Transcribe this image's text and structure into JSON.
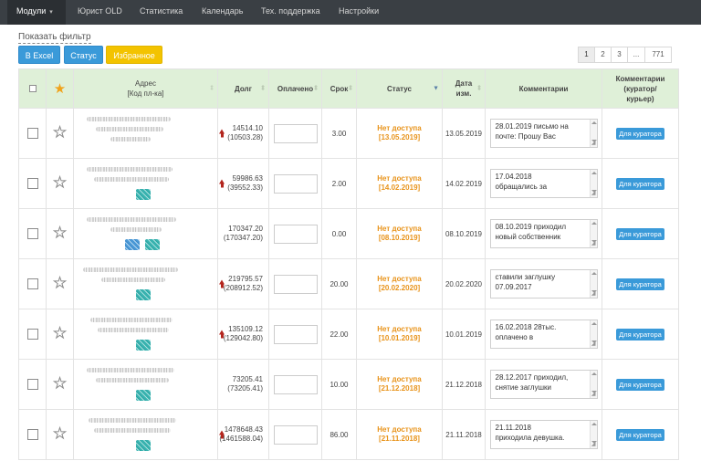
{
  "nav": {
    "items": [
      {
        "label": "Модули",
        "active": true,
        "has_caret": true
      },
      {
        "label": "Юрист OLD",
        "active": false
      },
      {
        "label": "Статистика",
        "active": false
      },
      {
        "label": "Календарь",
        "active": false
      },
      {
        "label": "Тех. поддержка",
        "active": false
      },
      {
        "label": "Настройки",
        "active": false
      }
    ]
  },
  "toolbar": {
    "show_filter": "Показать фильтр",
    "excel_label": "В Excel",
    "status_label": "Статус",
    "favorites_label": "Избранное"
  },
  "pagination": {
    "pages": [
      "1",
      "2",
      "3",
      "...",
      "771"
    ],
    "current": "1"
  },
  "table": {
    "headers": {
      "address": "Адрес",
      "address_sub": "[Код пл-ка]",
      "debt": "Долг",
      "paid": "Оплачено",
      "term": "Срок",
      "status": "Статус",
      "date": "Дата",
      "date_sub": "изм.",
      "comments": "Комментарии",
      "curator_comments_1": "Комментарии",
      "curator_comments_2": "(куратор/",
      "curator_comments_3": "курьер)"
    },
    "rows": [
      {
        "debt": "14514.10",
        "debt_sub": "(10503.28)",
        "debt_up": true,
        "term": "3.00",
        "status": "Нет доступа",
        "status_date": "[13.05.2019]",
        "date": "13.05.2019",
        "comment_1": "28.01.2019 письмо на",
        "comment_2": "почте: Прошу Вас",
        "curator_btn": "Для куратора"
      },
      {
        "debt": "59986.63",
        "debt_sub": "(39552.33)",
        "debt_up": true,
        "term": "2.00",
        "status": "Нет доступа",
        "status_date": "[14.02.2019]",
        "date": "14.02.2019",
        "comment_1": "17.04.2018",
        "comment_2": "обращались за",
        "curator_btn": "Для куратора"
      },
      {
        "debt": "170347.20",
        "debt_sub": "(170347.20)",
        "debt_up": false,
        "term": "0.00",
        "status": "Нет доступа",
        "status_date": "[08.10.2019]",
        "date": "08.10.2019",
        "comment_1": "08.10.2019 приходил",
        "comment_2": "новый собственник",
        "curator_btn": "Для куратора"
      },
      {
        "debt": "219795.57",
        "debt_sub": "(208912.52)",
        "debt_up": true,
        "term": "20.00",
        "status": "Нет доступа",
        "status_date": "[20.02.2020]",
        "date": "20.02.2020",
        "comment_1": "ставили заглушку",
        "comment_2": "07.09.2017",
        "curator_btn": "Для куратора"
      },
      {
        "debt": "135109.12",
        "debt_sub": "(129042.80)",
        "debt_up": true,
        "term": "22.00",
        "status": "Нет доступа",
        "status_date": "[10.01.2019]",
        "date": "10.01.2019",
        "comment_1": "16.02.2018 28тыс.",
        "comment_2": "оплачено в",
        "curator_btn": "Для куратора"
      },
      {
        "debt": "73205.41",
        "debt_sub": "(73205.41)",
        "debt_up": false,
        "term": "10.00",
        "status": "Нет доступа",
        "status_date": "[21.12.2018]",
        "date": "21.12.2018",
        "comment_1": "28.12.2017 приходил,",
        "comment_2": "снятие заглушки",
        "curator_btn": "Для куратора"
      },
      {
        "debt": "1478648.43",
        "debt_sub": "(1461588.04)",
        "debt_up": true,
        "term": "86.00",
        "status": "Нет доступа",
        "status_date": "[21.11.2018]",
        "date": "21.11.2018",
        "comment_1": "21.11.2018",
        "comment_2": "приходила девушка.",
        "curator_btn": "Для куратора"
      }
    ]
  },
  "colors": {
    "nav_bg": "#3a3f44",
    "header_bg": "#dff0d8",
    "accent_blue": "#3a9ad9",
    "accent_yellow": "#f3c300",
    "status_orange": "#e8931a",
    "debt_arrow_red": "#b3261e"
  }
}
